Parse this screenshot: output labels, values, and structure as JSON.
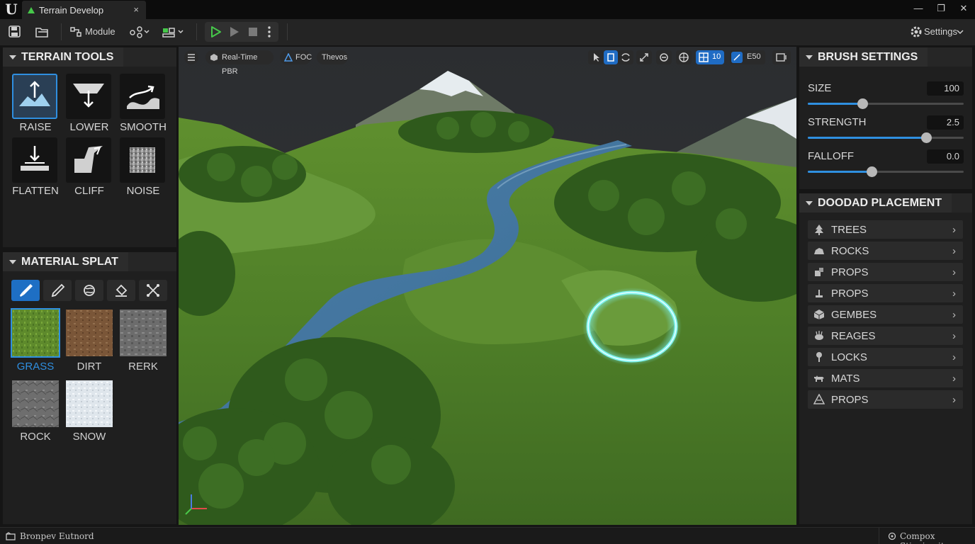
{
  "window": {
    "tab_title": "Terrain Develop",
    "tab_close": "×",
    "minimize": "—",
    "maximize": "❐",
    "close": "✕"
  },
  "toolbar": {
    "module_label": "Module",
    "settings_label": "Settings"
  },
  "terrain_tools": {
    "title": "TERRAIN TOOLS",
    "tools": [
      {
        "label": "RAISE",
        "icon": "raise-icon",
        "selected": true
      },
      {
        "label": "LOWER",
        "icon": "lower-icon",
        "selected": false
      },
      {
        "label": "SMOOTH",
        "icon": "smooth-icon",
        "selected": false
      },
      {
        "label": "FLATTEN",
        "icon": "flatten-icon",
        "selected": false
      },
      {
        "label": "CLIFF",
        "icon": "cliff-icon",
        "selected": false
      },
      {
        "label": "NOISE",
        "icon": "noise-icon",
        "selected": false
      }
    ]
  },
  "material_splat": {
    "title": "MATERIAL SPLAT",
    "tools": [
      "paint-brush-icon",
      "eyedropper-icon",
      "globe-icon",
      "fill-bucket-icon",
      "scatter-icon"
    ],
    "materials": [
      {
        "label": "GRASS",
        "selected": true
      },
      {
        "label": "DIRT",
        "selected": false
      },
      {
        "label": "RERK",
        "selected": false
      },
      {
        "label": "ROCK",
        "selected": false
      },
      {
        "label": "SNOW",
        "selected": false
      }
    ]
  },
  "viewport": {
    "render_mode": "Real-Time PBR",
    "fov_label": "FOC",
    "theme_label": "Thevos",
    "grid_value": "10",
    "camera_speed": "E50"
  },
  "brush_settings": {
    "title": "BRUSH SETTINGS",
    "size": {
      "label": "SIZE",
      "value": "100",
      "fraction": 0.35
    },
    "strength": {
      "label": "STRENGTH",
      "value": "2.5",
      "fraction": 0.76
    },
    "falloff": {
      "label": "FALLOFF",
      "value": "0.0",
      "fraction": 0.41
    }
  },
  "doodad_placement": {
    "title": "DOODAD PLACEMENT",
    "items": [
      {
        "label": "TREES",
        "icon": "tree-icon"
      },
      {
        "label": "ROCKS",
        "icon": "rock-icon"
      },
      {
        "label": "PROPS",
        "icon": "props-icon"
      },
      {
        "label": "PROPS",
        "icon": "stump-icon"
      },
      {
        "label": "GEMBES",
        "icon": "cube-icon"
      },
      {
        "label": "REAGES",
        "icon": "reeds-icon"
      },
      {
        "label": "LOCKS",
        "icon": "pin-icon"
      },
      {
        "label": "MATS",
        "icon": "animal-icon"
      },
      {
        "label": "PROPS",
        "icon": "cone-icon"
      }
    ],
    "arrow": "›"
  },
  "statusbar": {
    "left": "Bronpev Eutnord",
    "right": "Compox Stieniemit"
  },
  "colors": {
    "accent": "#2f8fe0",
    "brush_ring": "#7ff3f0",
    "play": "#46c84a"
  }
}
